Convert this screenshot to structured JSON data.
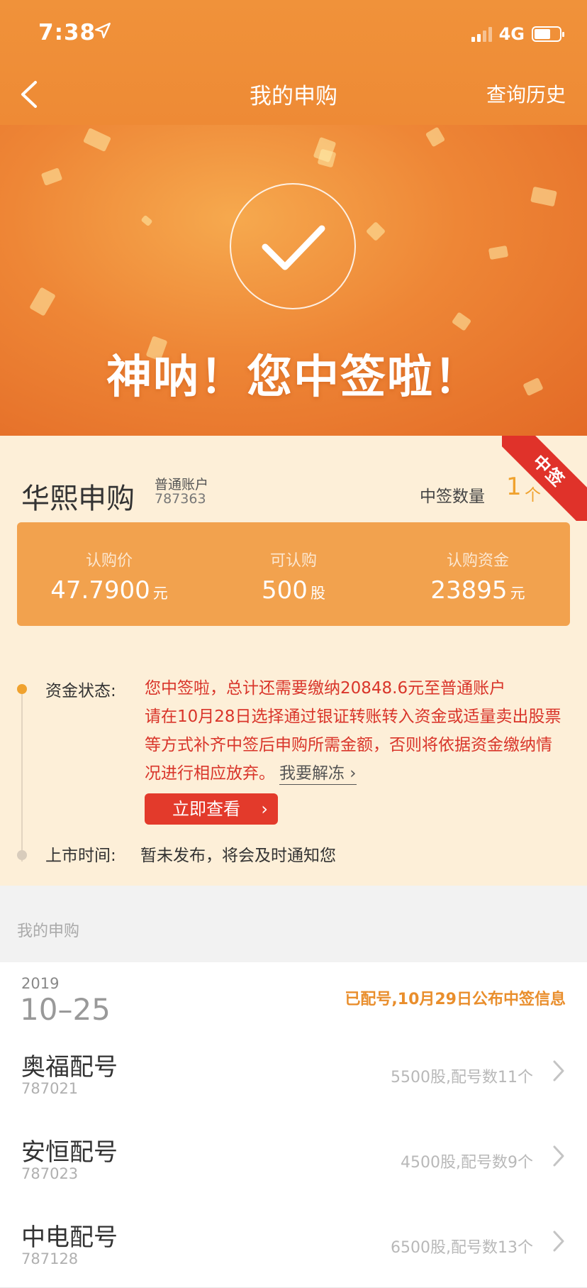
{
  "status_bar": {
    "time": "7:38",
    "network": "4G"
  },
  "nav": {
    "title": "我的申购",
    "history": "查询历史"
  },
  "banner": {
    "title": "神呐！您中签啦！"
  },
  "result": {
    "ribbon": "中签",
    "stock_name": "华熙申购",
    "account_type": "普通账户",
    "account_number": "787363",
    "win_count_label": "中签数量",
    "win_count_value": "1",
    "win_count_unit": "个",
    "info": [
      {
        "label": "认购价",
        "value": "47.7900",
        "unit": "元"
      },
      {
        "label": "可认购",
        "value": "500",
        "unit": "股"
      },
      {
        "label": "认购资金",
        "value": "23895",
        "unit": "元"
      }
    ],
    "fund_status_label": "资金状态:",
    "fund_status_line1": "您中签啦，总计还需要缴纳20848.6元至普通账户",
    "fund_status_line2": "请在10月28日选择通过银证转账转入资金或适量卖出股票等方式补齐中签后申购所需金额，否则将依据资金缴纳情况进行相应放弃。",
    "unfreeze_link": "我要解冻",
    "view_button": "立即查看",
    "listing_label": "上市时间:",
    "listing_value": "暂未发布，将会及时通知您"
  },
  "subscriptions": {
    "section_title": "我的申购",
    "date_year": "2019",
    "date_day": "10–25",
    "date_status": "已配号,10月29日公布中签信息",
    "items": [
      {
        "name": "奥福配号",
        "code": "787021",
        "detail": "5500股,配号数11个"
      },
      {
        "name": "安恒配号",
        "code": "787023",
        "detail": "4500股,配号数9个"
      },
      {
        "name": "中电配号",
        "code": "787128",
        "detail": "6500股,配号数13个"
      }
    ]
  },
  "colors": {
    "header_orange": "#f0923a",
    "accent_orange": "#f2a24e",
    "alert_red": "#d9352a",
    "button_red": "#e33a2b",
    "ribbon_red": "#e0322a"
  }
}
